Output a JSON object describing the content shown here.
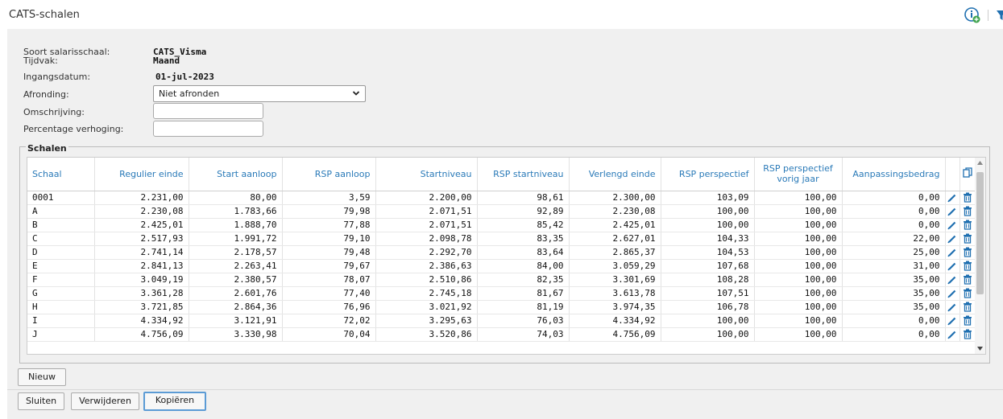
{
  "title": "CATS-schalen",
  "fields": {
    "soort_label": "Soort salarisschaal:",
    "soort_value": "CATS_Visma",
    "tijdvak_label": "Tijdvak:",
    "tijdvak_value": "Maand",
    "ingangsdatum_label": "Ingangsdatum:",
    "ingangsdatum_value": "01-jul-2023",
    "afronding_label": "Afronding:",
    "afronding_value": "Niet afronden",
    "omschrijving_label": "Omschrijving:",
    "omschrijving_value": "",
    "percentage_label": "Percentage verhoging:",
    "percentage_value": ""
  },
  "schalen": {
    "legend": "Schalen",
    "columns": [
      "Schaal",
      "Regulier einde",
      "Start aanloop",
      "RSP aanloop",
      "Startniveau",
      "RSP startniveau",
      "Verlengd einde",
      "RSP perspectief",
      "RSP perspectief vorig jaar",
      "Aanpassingsbedrag"
    ],
    "rows": [
      [
        "0001",
        "2.231,00",
        "80,00",
        "3,59",
        "2.200,00",
        "98,61",
        "2.300,00",
        "103,09",
        "100,00",
        "0,00"
      ],
      [
        "A",
        "2.230,08",
        "1.783,66",
        "79,98",
        "2.071,51",
        "92,89",
        "2.230,08",
        "100,00",
        "100,00",
        "0,00"
      ],
      [
        "B",
        "2.425,01",
        "1.888,70",
        "77,88",
        "2.071,51",
        "85,42",
        "2.425,01",
        "100,00",
        "100,00",
        "0,00"
      ],
      [
        "C",
        "2.517,93",
        "1.991,72",
        "79,10",
        "2.098,78",
        "83,35",
        "2.627,01",
        "104,33",
        "100,00",
        "22,00"
      ],
      [
        "D",
        "2.741,14",
        "2.178,57",
        "79,48",
        "2.292,70",
        "83,64",
        "2.865,37",
        "104,53",
        "100,00",
        "25,00"
      ],
      [
        "E",
        "2.841,13",
        "2.263,41",
        "79,67",
        "2.386,63",
        "84,00",
        "3.059,29",
        "107,68",
        "100,00",
        "31,00"
      ],
      [
        "F",
        "3.049,19",
        "2.380,57",
        "78,07",
        "2.510,86",
        "82,35",
        "3.301,69",
        "108,28",
        "100,00",
        "35,00"
      ],
      [
        "G",
        "3.361,28",
        "2.601,76",
        "77,40",
        "2.745,18",
        "81,67",
        "3.613,78",
        "107,51",
        "100,00",
        "35,00"
      ],
      [
        "H",
        "3.721,85",
        "2.864,36",
        "76,96",
        "3.021,92",
        "81,19",
        "3.974,35",
        "106,78",
        "100,00",
        "35,00"
      ],
      [
        "I",
        "4.334,92",
        "3.121,91",
        "72,02",
        "3.295,63",
        "76,03",
        "4.334,92",
        "100,00",
        "100,00",
        "0,00"
      ],
      [
        "J",
        "4.756,09",
        "3.330,98",
        "70,04",
        "3.520,86",
        "74,03",
        "4.756,09",
        "100,00",
        "100,00",
        "0,00"
      ]
    ]
  },
  "buttons": {
    "nieuw": "Nieuw",
    "sluiten": "Sluiten",
    "verwijderen": "Verwijderen",
    "kopieren": "Kopiëren"
  },
  "colors": {
    "header_text": "#2a7ab8",
    "icon_blue": "#1f6fb0",
    "info_green": "#3fa34d"
  },
  "icons": [
    "info-add-icon",
    "filter-icon",
    "copy-icon",
    "edit-icon",
    "delete-icon",
    "chevron-down-icon"
  ]
}
